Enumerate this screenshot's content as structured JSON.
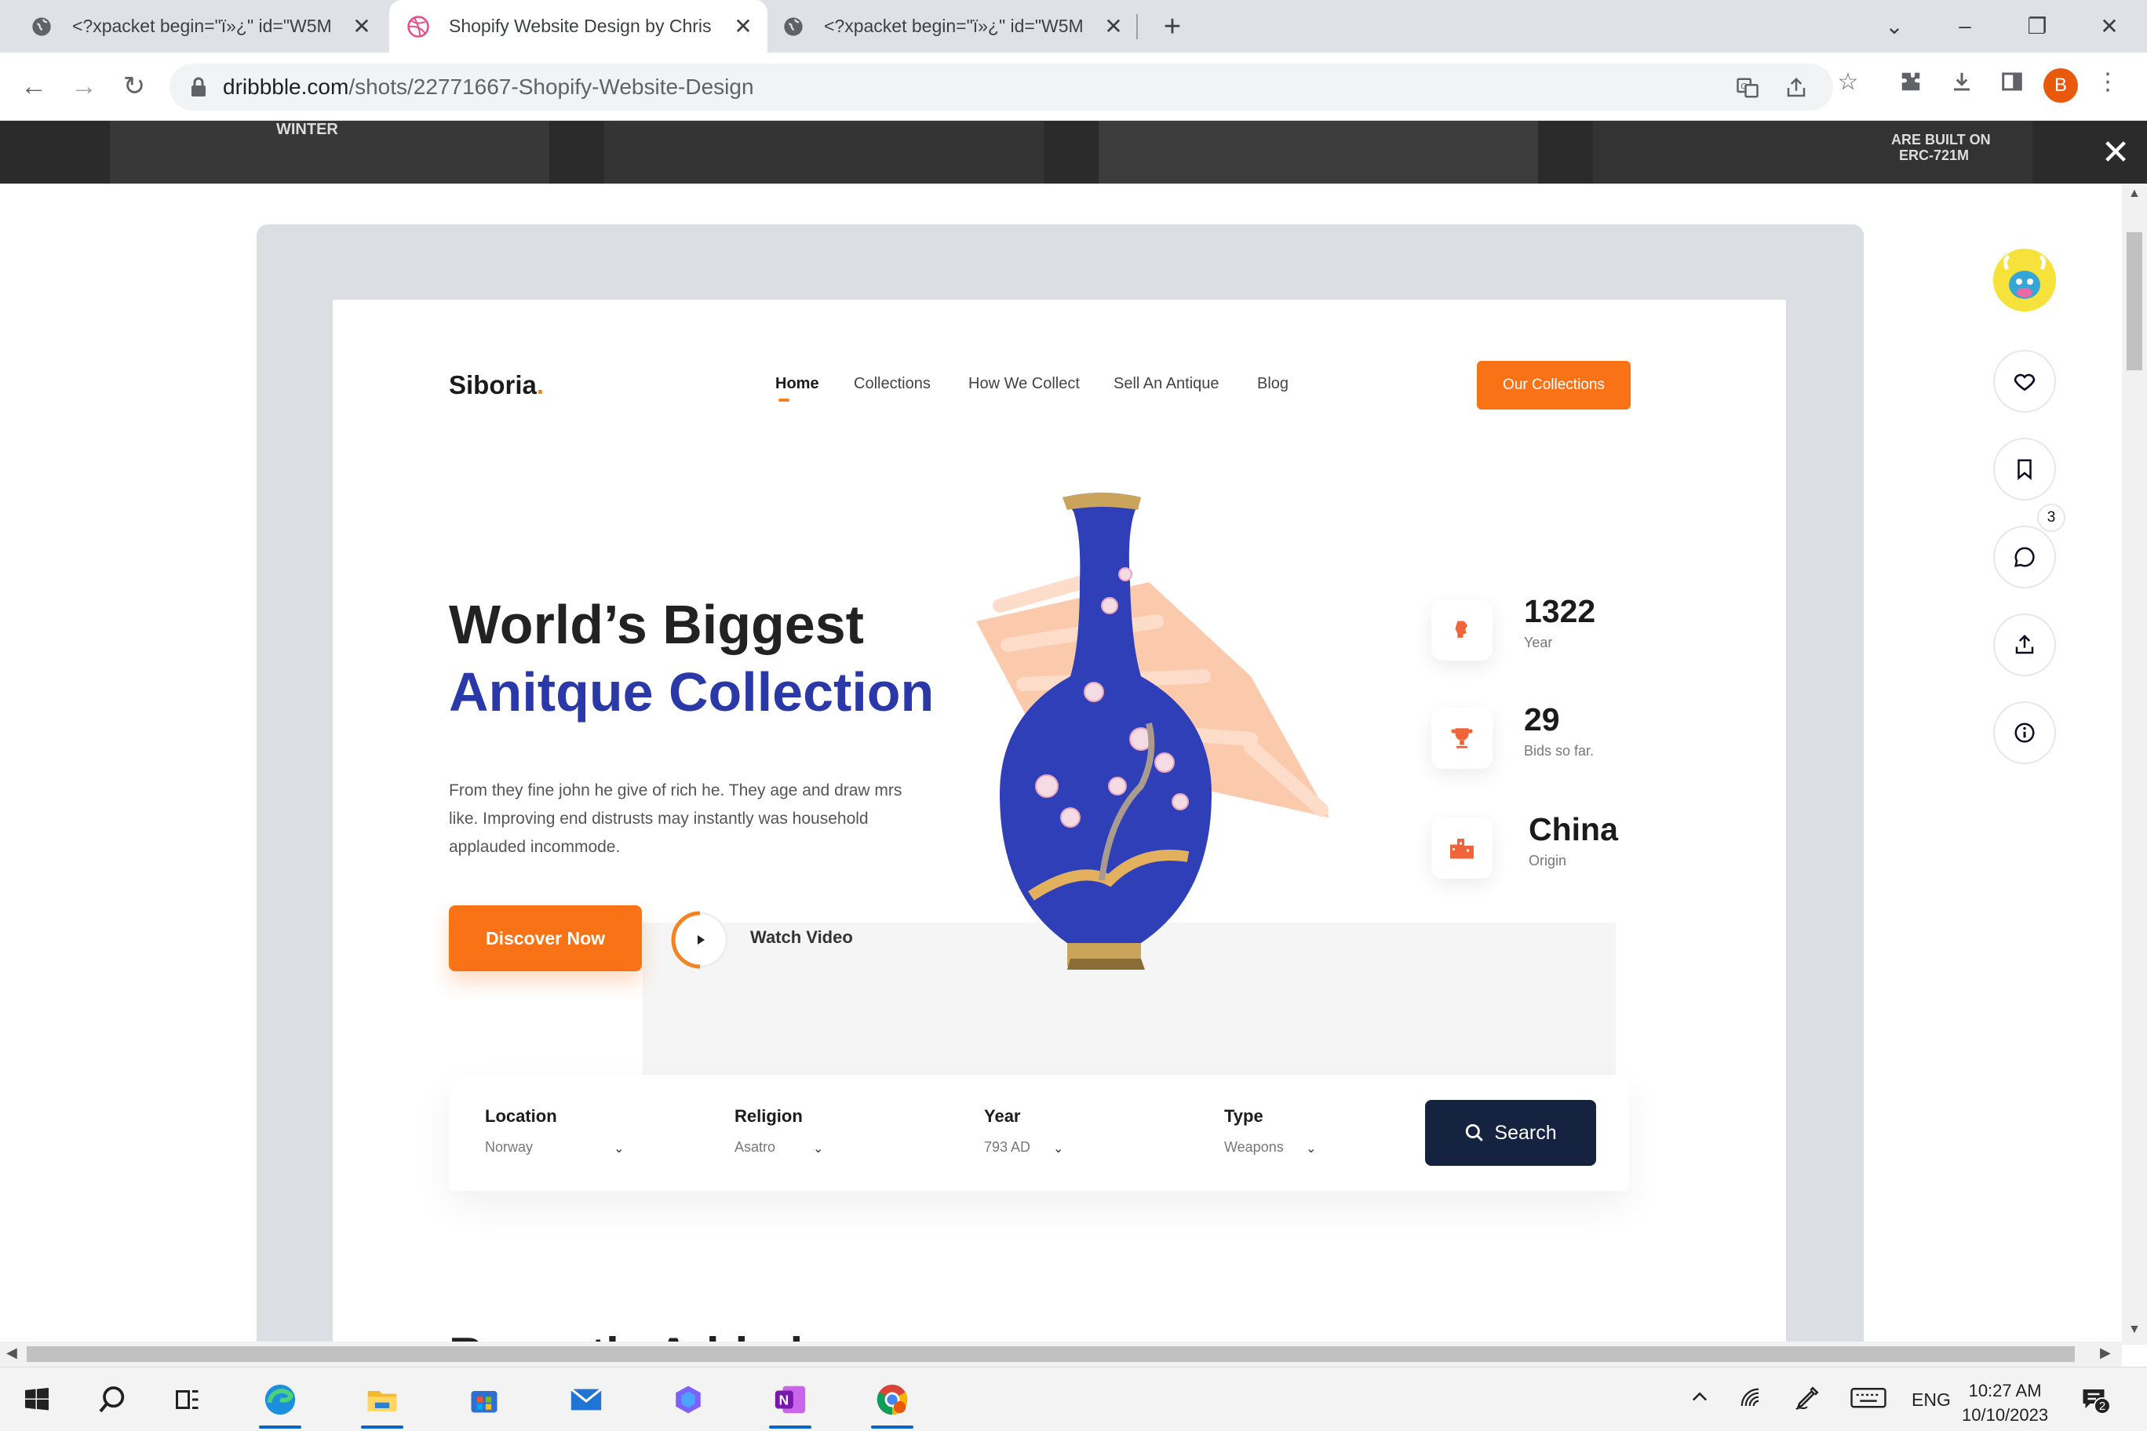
{
  "browser": {
    "tabs": [
      {
        "title": "<?xpacket begin=\"ï»¿\" id=\"W5M",
        "active": false,
        "icon": "globe-icon"
      },
      {
        "title": "Shopify Website Design by Chris",
        "active": true,
        "icon": "dribbble-icon"
      },
      {
        "title": "<?xpacket begin=\"ï»¿\" id=\"W5M",
        "active": false,
        "icon": "globe-icon"
      }
    ],
    "address": {
      "domain": "dribbble.com",
      "path": "/shots/22771667-Shopify-Website-Design"
    },
    "profile_initial": "B"
  },
  "backdrop": {
    "texts": [
      "WINTER",
      "ARE BUILT ON",
      "ERC-721M"
    ]
  },
  "site": {
    "logo": "Siboria",
    "logo_dot": ".",
    "nav": [
      "Home",
      "Collections",
      "How We Collect",
      "Sell An Antique",
      "Blog"
    ],
    "cta_top": "Our Collections",
    "hero_line1": "World’s Biggest",
    "hero_line2": "Anitque Collection",
    "hero_paragraph": "From they fine john he give of rich he. They age and draw mrs like. Improving end distrusts may instantly was household applauded incommode.",
    "discover": "Discover Now",
    "watch": "Watch Video",
    "stats": [
      {
        "value": "1322",
        "label": "Year",
        "icon": "bust-icon"
      },
      {
        "value": "29",
        "label": "Bids so far.",
        "icon": "trophy-icon"
      },
      {
        "value": "China",
        "label": "Origin",
        "icon": "buildings-icon"
      }
    ],
    "search_fields": [
      {
        "label": "Location",
        "value": "Norway"
      },
      {
        "label": "Religion",
        "value": "Asatro"
      },
      {
        "label": "Year",
        "value": "793 AD"
      },
      {
        "label": "Type",
        "value": "Weapons"
      }
    ],
    "search_button": "Search",
    "recent_heading": "Recently Added"
  },
  "actions": {
    "comment_count": "3"
  },
  "taskbar": {
    "language": "ENG",
    "time": "10:27 AM",
    "date": "10/10/2023",
    "notification_count": "2"
  },
  "colors": {
    "accent": "#f97316",
    "brand_blue": "#2a38a8",
    "search_navy": "#152340"
  }
}
